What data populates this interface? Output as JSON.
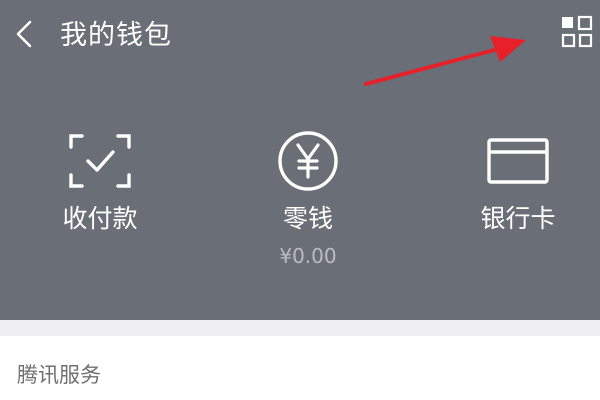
{
  "header": {
    "title": "我的钱包",
    "back_icon": "chevron-left-icon",
    "more_icon": "grid-icon",
    "background": "#6a6e77"
  },
  "features": [
    {
      "label": "收付款",
      "icon": "scan-check-icon"
    },
    {
      "label": "零钱",
      "icon": "yuan-coin-icon",
      "balance": "¥0.00"
    },
    {
      "label": "银行卡",
      "icon": "bank-card-icon"
    }
  ],
  "section": {
    "title": "腾讯服务"
  },
  "annotation": {
    "arrow_color": "#e8202a"
  }
}
